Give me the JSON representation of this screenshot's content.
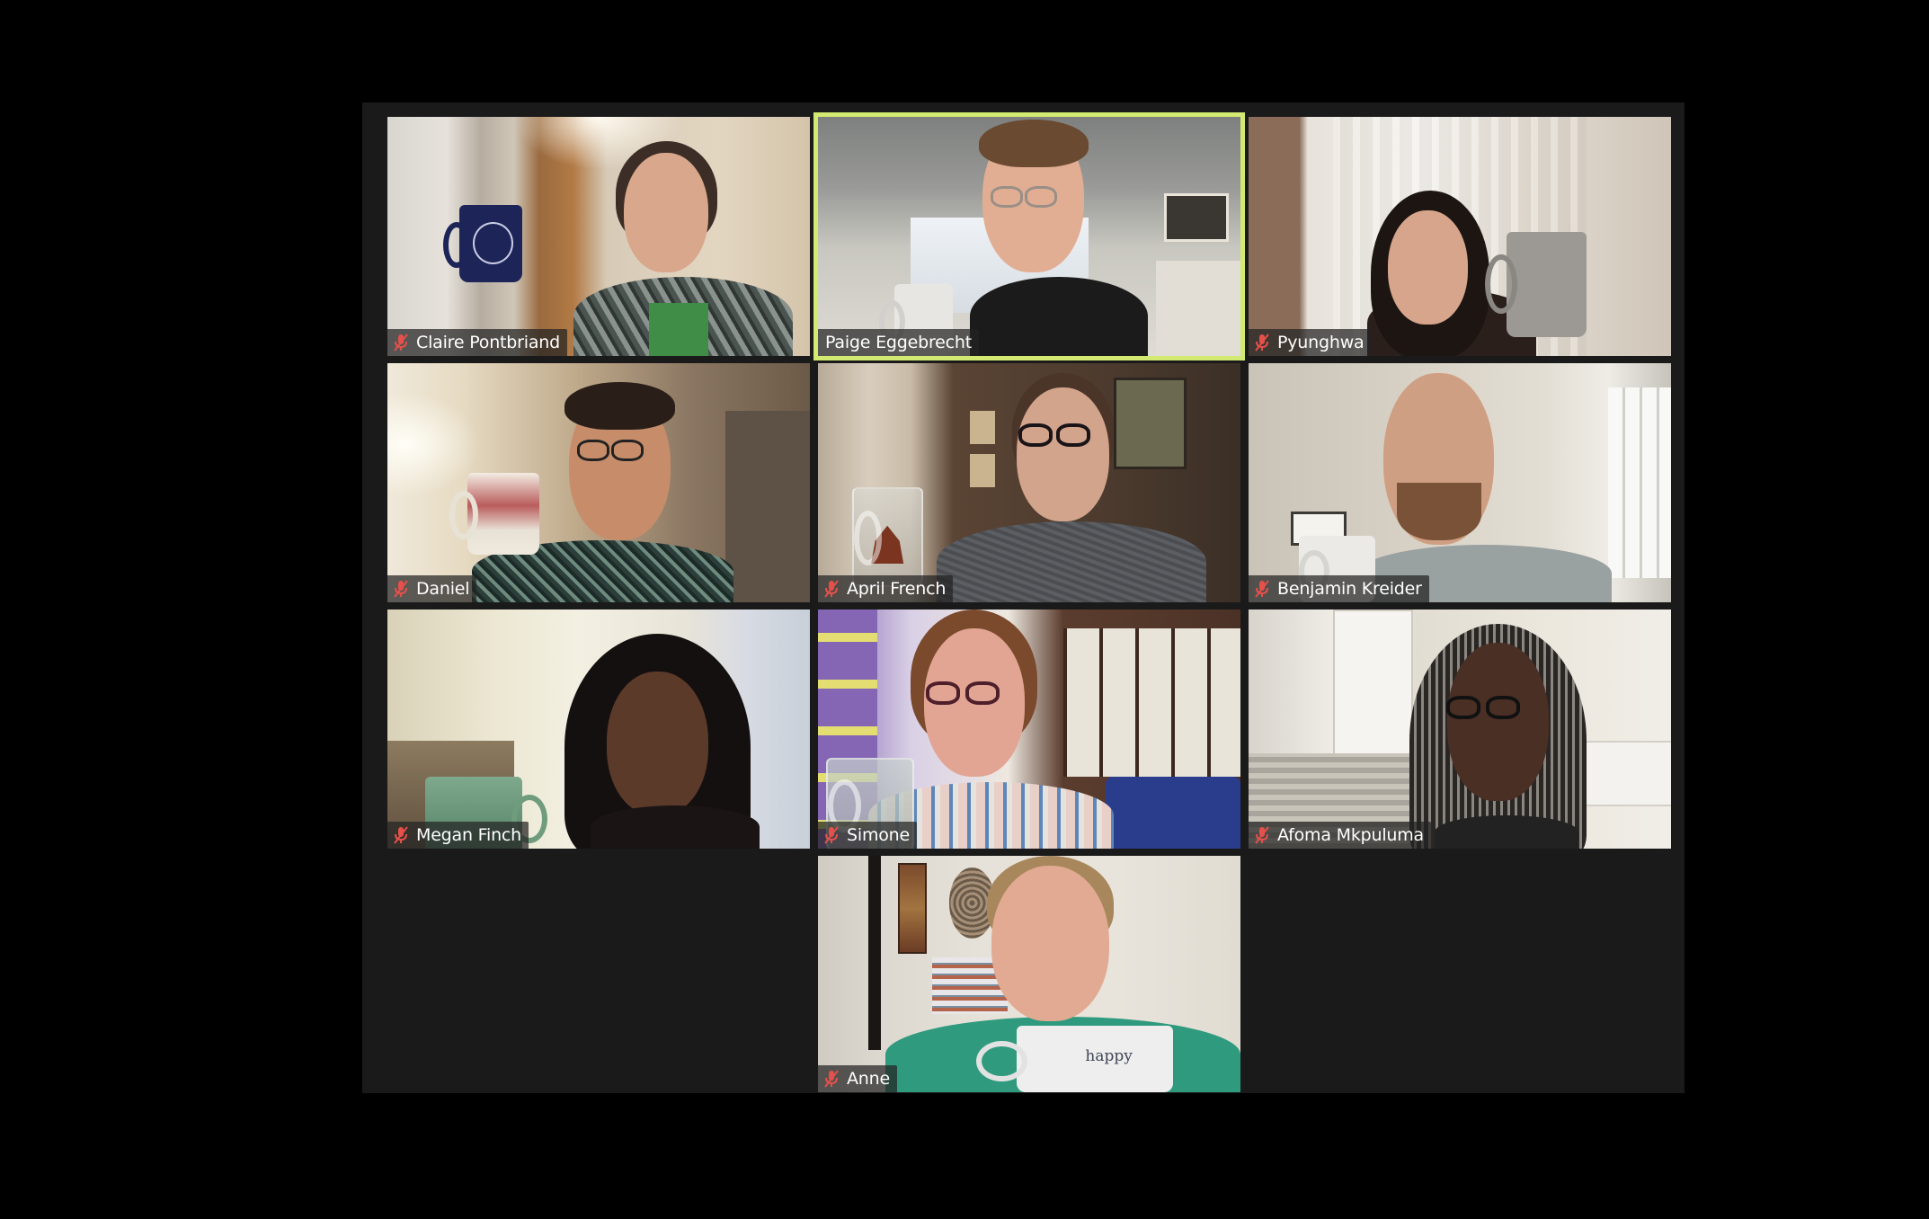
{
  "app": {
    "view": "Gallery View",
    "active_speaker_color": "#d2ea72",
    "muted_icon_color": "#e5504b"
  },
  "participants": [
    {
      "name": "Claire Pontbriand",
      "muted": true,
      "active_speaker": false,
      "row": 1,
      "col": 1
    },
    {
      "name": "Paige Eggebrecht",
      "muted": false,
      "active_speaker": true,
      "row": 1,
      "col": 2
    },
    {
      "name": "Pyunghwa",
      "muted": true,
      "active_speaker": false,
      "row": 1,
      "col": 3
    },
    {
      "name": "Daniel",
      "muted": true,
      "active_speaker": false,
      "row": 2,
      "col": 1
    },
    {
      "name": "April French",
      "muted": true,
      "active_speaker": false,
      "row": 2,
      "col": 2
    },
    {
      "name": "Benjamin Kreider",
      "muted": true,
      "active_speaker": false,
      "row": 2,
      "col": 3
    },
    {
      "name": "Megan Finch",
      "muted": true,
      "active_speaker": false,
      "row": 3,
      "col": 1
    },
    {
      "name": "Simone",
      "muted": true,
      "active_speaker": false,
      "row": 3,
      "col": 2
    },
    {
      "name": "Afoma Mkpuluma",
      "muted": true,
      "active_speaker": false,
      "row": 3,
      "col": 3
    },
    {
      "name": "Anne",
      "muted": true,
      "active_speaker": false,
      "row": 4,
      "col": 2
    }
  ],
  "mug_text": {
    "anne": "happy"
  },
  "icons": {
    "muted": "muted-microphone-icon"
  }
}
